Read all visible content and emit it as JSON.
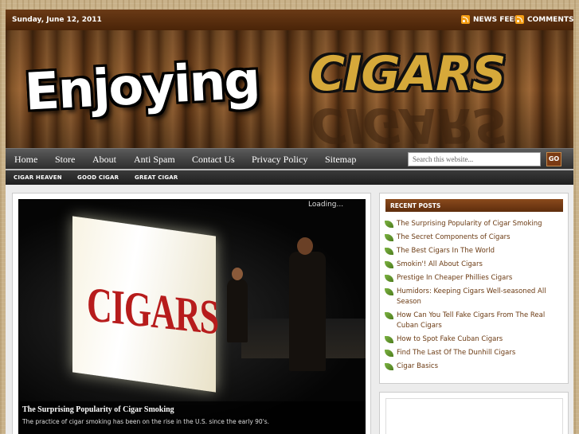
{
  "topbar": {
    "date": "Sunday, June 12, 2011",
    "news_feed": "NEWS FEED",
    "comments": "COMMENTS"
  },
  "header": {
    "logo_word1": "Enjoying",
    "logo_word2": "CIGARS"
  },
  "nav": {
    "items": [
      "Home",
      "Store",
      "About",
      "Anti Spam",
      "Contact Us",
      "Privacy Policy",
      "Sitemap"
    ],
    "search_placeholder": "Search this website...",
    "go_label": "GO"
  },
  "subnav": {
    "items": [
      "CIGAR HEAVEN",
      "GOOD CIGAR",
      "GREAT CIGAR"
    ]
  },
  "slider": {
    "loading": "Loading...",
    "sign_text": "CIGARS",
    "caption_title": "The Surprising Popularity of Cigar Smoking",
    "caption_text": "The practice of cigar smoking has been on the rise in the U.S. since the early 90's."
  },
  "sidebar": {
    "heading": "RECENT POSTS",
    "posts": [
      "The Surprising Popularity of Cigar Smoking",
      "The Secret Components of Cigars",
      "The Best Cigars In The World",
      "Smokin'! All About Cigars",
      "Prestige In Cheaper Phillies Cigars",
      "Humidors: Keeping Cigars Well-seasoned All Season",
      "How Can You Tell Fake Cigars From The Real Cuban Cigars",
      "How to Spot Fake Cuban Cigars",
      "Find The Last Of The Dunhill Cigars",
      "Cigar Basics"
    ]
  },
  "colors": {
    "accent_brown": "#6b3a12",
    "logo_gold": "#d6a93a",
    "sign_red": "#b71c1c"
  }
}
